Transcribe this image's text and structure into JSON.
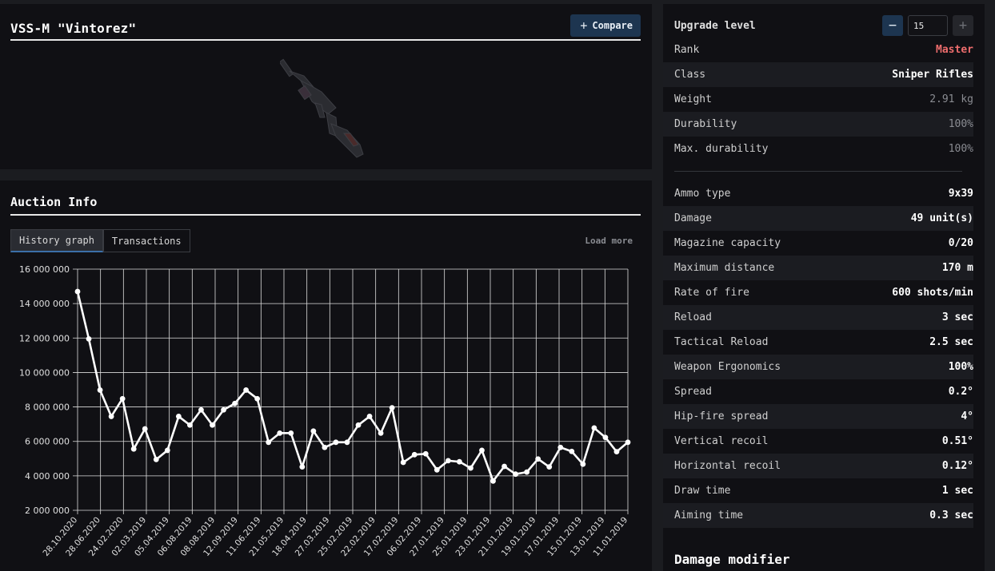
{
  "item": {
    "title": "VSS-M \"Vintorez\"",
    "compare_label": "Compare",
    "image_alt": "weapon-image"
  },
  "auction": {
    "title": "Auction Info",
    "tabs": [
      "History graph",
      "Transactions"
    ],
    "active_tab": "History graph",
    "load_more": "Load more"
  },
  "chart_data": {
    "type": "line",
    "title": "",
    "xlabel": "",
    "ylabel": "",
    "ylim": [
      2000000,
      16000000
    ],
    "y_ticks": [
      "2 000 000",
      "4 000 000",
      "6 000 000",
      "8 000 000",
      "10 000 000",
      "12 000 000",
      "14 000 000",
      "16 000 000"
    ],
    "x_tick_labels": [
      "28.10.2020",
      "28.06.2020",
      "24.02.2020",
      "02.03.2019",
      "05.04.2019",
      "06.08.2019",
      "08.08.2019",
      "12.09.2019",
      "11.06.2019",
      "21.05.2019",
      "18.04.2019",
      "27.03.2019",
      "25.02.2019",
      "22.02.2019",
      "17.02.2019",
      "06.02.2019",
      "27.01.2019",
      "25.01.2019",
      "23.01.2019",
      "21.01.2019",
      "19.01.2019",
      "17.01.2019",
      "15.01.2019",
      "13.01.2019",
      "11.01.2019"
    ],
    "grid": true,
    "values": [
      14700000,
      11950000,
      8980000,
      7450000,
      8480000,
      5560000,
      6730000,
      4950000,
      5480000,
      7450000,
      6950000,
      7830000,
      6950000,
      7830000,
      8200000,
      8980000,
      8480000,
      5950000,
      6480000,
      6480000,
      4520000,
      6600000,
      5650000,
      5950000,
      5950000,
      6950000,
      7450000,
      6480000,
      7950000,
      4780000,
      5230000,
      5280000,
      4350000,
      4880000,
      4820000,
      4450000,
      5480000,
      3700000,
      4550000,
      4100000,
      4220000,
      4980000,
      4520000,
      5650000,
      5420000,
      4680000,
      6780000,
      6230000,
      5400000,
      5950000
    ]
  },
  "upgrade": {
    "label": "Upgrade level",
    "value": "15",
    "minus_icon": "minus",
    "plus_icon": "plus"
  },
  "stats_general": [
    {
      "label": "Rank",
      "value": "Master",
      "style": "rank"
    },
    {
      "label": "Class",
      "value": "Sniper Rifles",
      "style": "bold"
    },
    {
      "label": "Weight",
      "value": "2.91 kg",
      "style": "dim"
    },
    {
      "label": "Durability",
      "value": "100%",
      "style": "dim"
    },
    {
      "label": "Max. durability",
      "value": "100%",
      "style": "dim"
    }
  ],
  "stats_weapon": [
    {
      "label": "Ammo type",
      "value": "9x39",
      "style": "bold"
    },
    {
      "label": "Damage",
      "value": "49 unit(s)",
      "style": "bold"
    },
    {
      "label": "Magazine capacity",
      "value": "0/20",
      "style": "bold"
    },
    {
      "label": "Maximum distance",
      "value": "170 m",
      "style": "bold"
    },
    {
      "label": "Rate of fire",
      "value": "600 shots/min",
      "style": "bold"
    },
    {
      "label": "Reload",
      "value": "3 sec",
      "style": "bold"
    },
    {
      "label": "Tactical Reload",
      "value": "2.5 sec",
      "style": "bold"
    },
    {
      "label": "Weapon Ergonomics",
      "value": "100%",
      "style": "bold"
    },
    {
      "label": "Spread",
      "value": "0.2°",
      "style": "bold"
    },
    {
      "label": "Hip-fire spread",
      "value": "4°",
      "style": "bold"
    },
    {
      "label": "Vertical recoil",
      "value": "0.51°",
      "style": "bold"
    },
    {
      "label": "Horizontal recoil",
      "value": "0.12°",
      "style": "bold"
    },
    {
      "label": "Draw time",
      "value": "1 sec",
      "style": "bold"
    },
    {
      "label": "Aiming time",
      "value": "0.3 sec",
      "style": "bold"
    }
  ],
  "damage_modifier": {
    "title": "Damage modifier"
  }
}
